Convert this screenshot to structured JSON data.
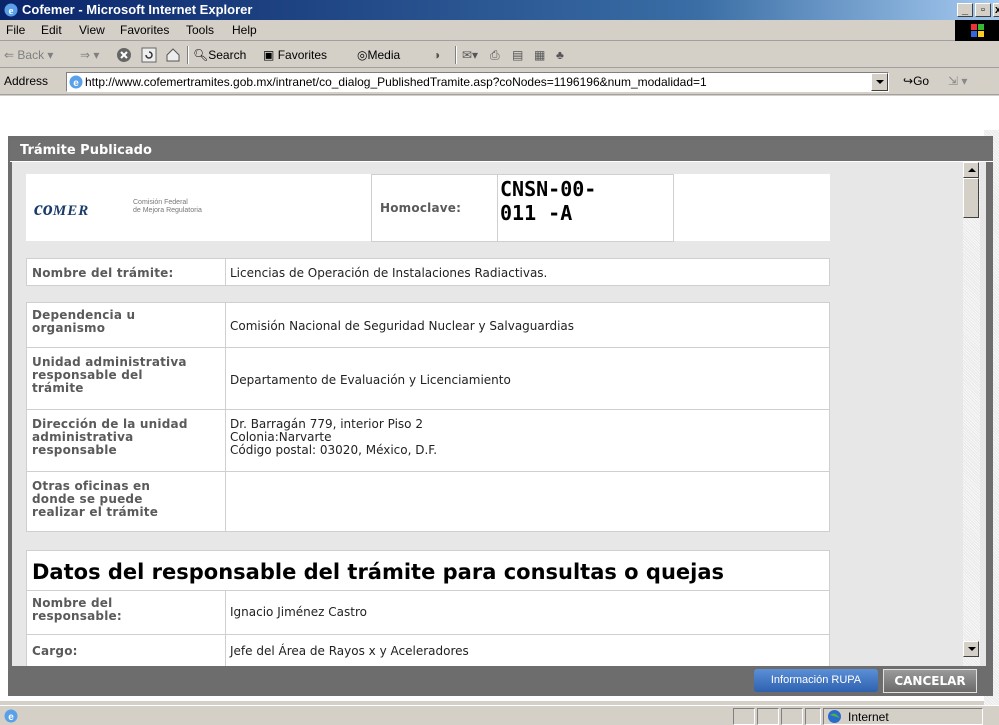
{
  "window": {
    "title": "Cofemer - Microsoft Internet Explorer"
  },
  "menu": [
    "File",
    "Edit",
    "View",
    "Favorites",
    "Tools",
    "Help"
  ],
  "toolbar": {
    "back": "Back",
    "search": "Search",
    "favorites": "Favorites",
    "media": "Media"
  },
  "address": {
    "label": "Address",
    "url": "http://www.cofemertramites.gob.mx/intranet/co_dialog_PublishedTramite.asp?coNodes=1196196&num_modalidad=1",
    "go": "Go"
  },
  "panel": {
    "title": "Trámite Publicado"
  },
  "header": {
    "logo_text": "co",
    "logo_mark": "MER",
    "logo_sub1": "Comisión Federal",
    "logo_sub2": "de Mejora Regulatoria",
    "homoclave_label": "Homoclave:",
    "homoclave_line1": "CNSN-00-",
    "homoclave_line2": "011 -A"
  },
  "tramite": {
    "label": "Nombre del trámite:",
    "value": "Licencias de Operación de Instalaciones Radiactivas."
  },
  "rows": [
    {
      "label1": "Dependencia u",
      "label2": "organismo",
      "label3": "",
      "label4": "",
      "value1": "Comisión Nacional de Seguridad Nuclear y Salvaguardias",
      "value2": "",
      "value3": ""
    },
    {
      "label1": "Unidad administrativa",
      "label2": "responsable del",
      "label3": "trámite",
      "label4": "",
      "value1": "Departamento de Evaluación y Licenciamiento",
      "value2": "",
      "value3": ""
    },
    {
      "label1": "Dirección de la unidad",
      "label2": "administrativa",
      "label3": "responsable",
      "label4": "",
      "value1": "Dr. Barragán 779, interior Piso 2",
      "value2": "Colonia:Narvarte",
      "value3": "Código postal: 03020, México, D.F."
    },
    {
      "label1": "Otras oficinas en",
      "label2": "donde se puede",
      "label3": "realizar el trámite",
      "label4": "",
      "value1": "",
      "value2": "",
      "value3": ""
    }
  ],
  "responsable": {
    "heading": "Datos del responsable del trámite para consultas o quejas",
    "nombre_label1": "Nombre del",
    "nombre_label2": "responsable:",
    "nombre_value": "Ignacio Jiménez Castro",
    "cargo_label": "Cargo:",
    "cargo_value": "Jefe del Área de Rayos x y Aceleradores"
  },
  "buttons": {
    "rupa": "Información RUPA",
    "cancel": "CANCELAR"
  },
  "status": {
    "zone": "Internet"
  }
}
